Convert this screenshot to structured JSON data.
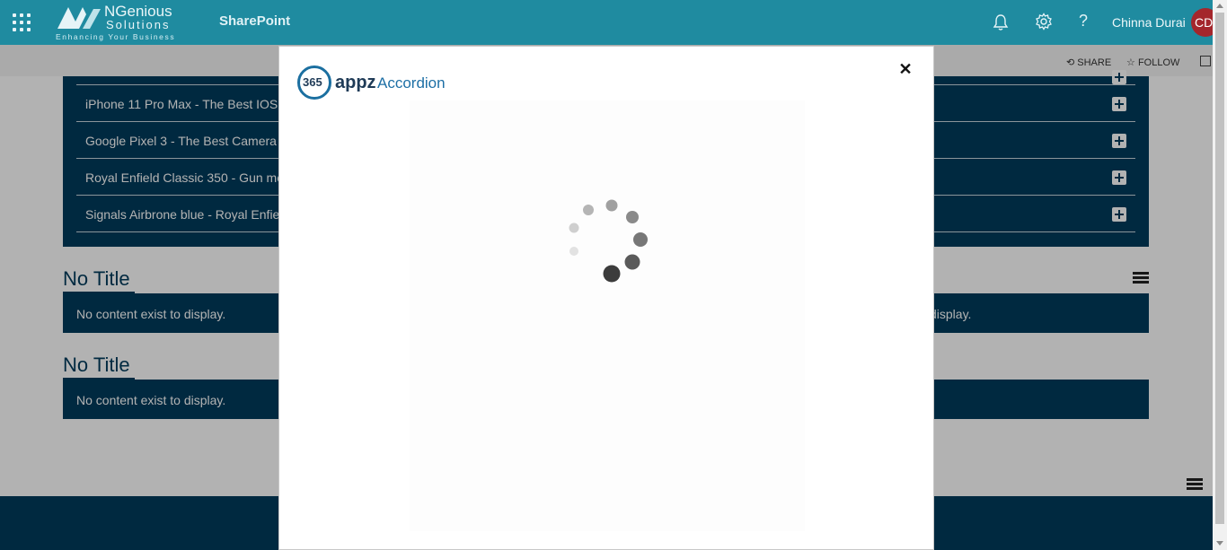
{
  "suitebar": {
    "logo_name": "NGenious",
    "logo_name2": "Solutions",
    "logo_tagline": "Enhancing Your Business",
    "app_title": "SharePoint",
    "help_label": "?",
    "user_name": "Chinna Durai",
    "avatar_initials": "CD",
    "icons": [
      "app-launcher-icon",
      "bell-icon",
      "gear-icon",
      "help-icon"
    ]
  },
  "commandbar": {
    "share_label": "SHARE",
    "follow_label": "FOLLOW"
  },
  "accordion": {
    "items": [
      {
        "label": "iPhone 11 Pro Max - The Best IOS"
      },
      {
        "label": "Google Pixel 3 - The Best Camera"
      },
      {
        "label": "Royal Enfield Classic 350 - Gun me"
      },
      {
        "label": "Signals Airbrone blue - Royal Enfie"
      }
    ]
  },
  "sections": [
    {
      "title": "No Title",
      "message": "No content exist to display.",
      "message_right": "display."
    },
    {
      "title": "No Title",
      "message": "No content exist to display."
    }
  ],
  "modal": {
    "logo_365": "365",
    "logo_appz": "appz",
    "logo_product": "Accordion",
    "close_label": "✕",
    "state": "loading"
  },
  "colors": {
    "suitebar": "#1f8ba0",
    "accordion_bg": "#003b5c",
    "avatar": "#a4262c"
  }
}
